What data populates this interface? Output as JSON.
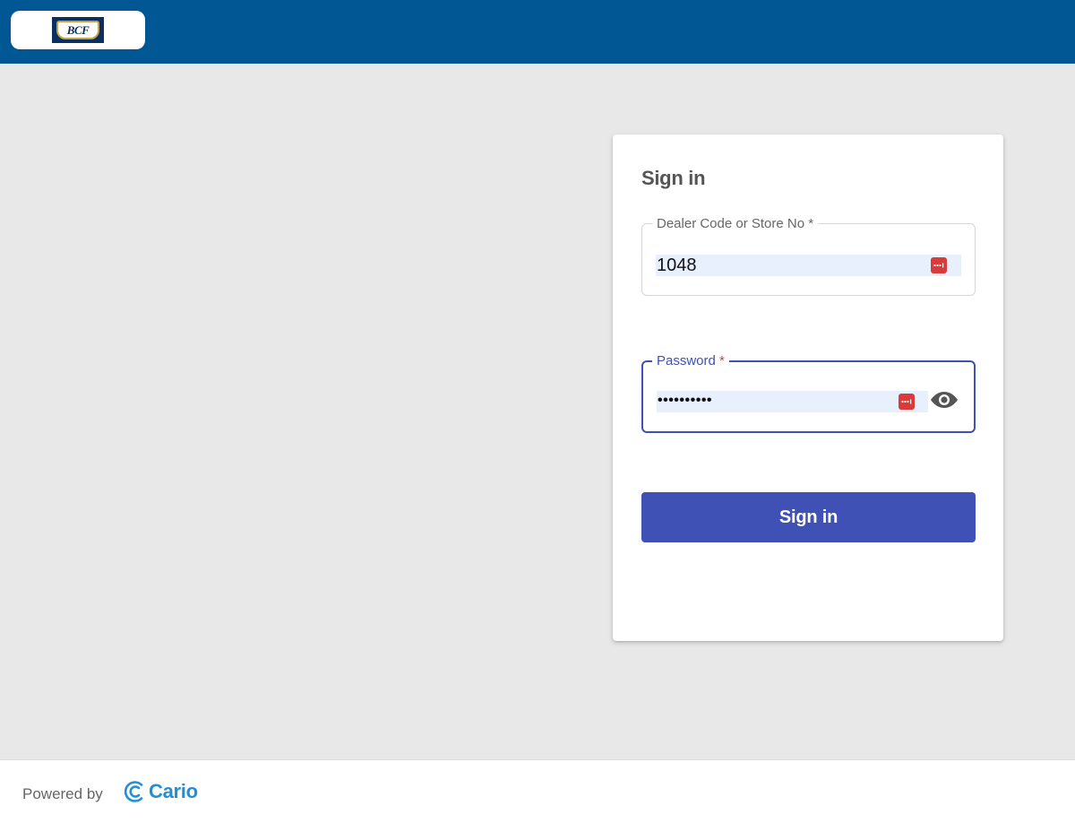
{
  "header": {
    "logo_text": "BCF",
    "colors": {
      "bar": "#005794"
    }
  },
  "signin": {
    "title": "Sign in",
    "dealer_field": {
      "label": "Dealer Code or Store No",
      "required_mark": "*",
      "value": "1048",
      "icon": "autofill-key-icon"
    },
    "password_field": {
      "label": "Password",
      "required_mark": "*",
      "masked_value": "••••••••••",
      "icon": "autofill-key-icon",
      "toggle_icon": "eye-icon"
    },
    "button_label": "Sign in",
    "colors": {
      "primary": "#3f51b5",
      "autofill": "#d93a3a"
    }
  },
  "footer": {
    "powered_by": "Powered by",
    "brand": "Cario",
    "colors": {
      "brand": "#1e8fd8"
    }
  }
}
